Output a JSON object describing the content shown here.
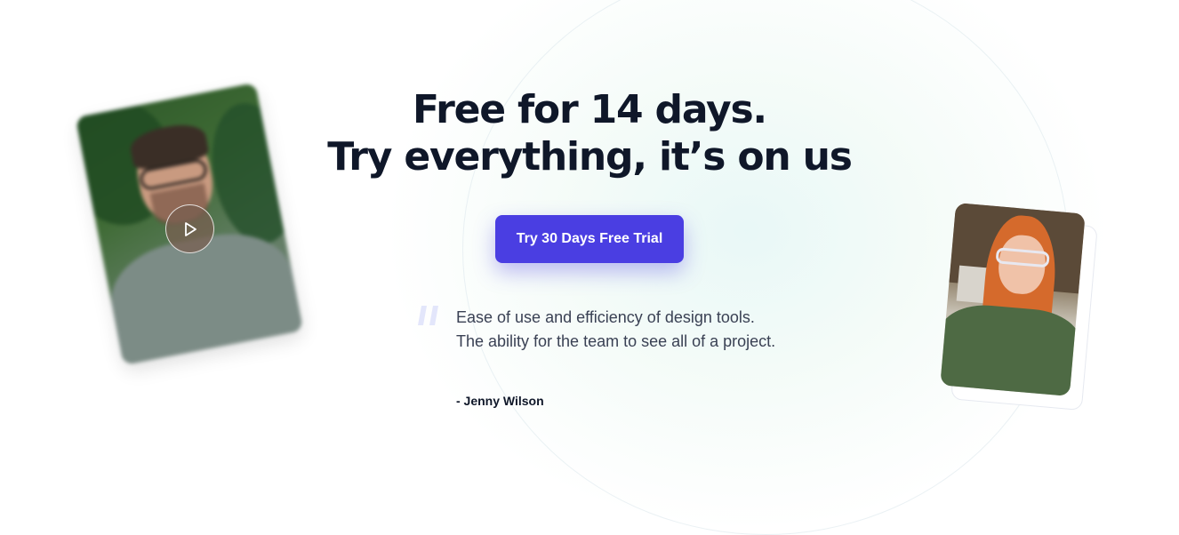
{
  "hero": {
    "headline_line1": "Free for 14 days.",
    "headline_line2": "Try everything, it’s on us",
    "cta_label": "Try 30 Days Free Trial"
  },
  "testimonial": {
    "quote": "Ease of use and efficiency of design tools. The ability for the team to see all of a project.",
    "author": "- Jenny Wilson"
  },
  "colors": {
    "accent": "#4a3ee2",
    "heading": "#0f1729",
    "body_text": "#3a4154",
    "quote_mark": "#e3e6fb"
  },
  "icons": {
    "play": "play-icon",
    "quote": "quote-mark-icon"
  }
}
